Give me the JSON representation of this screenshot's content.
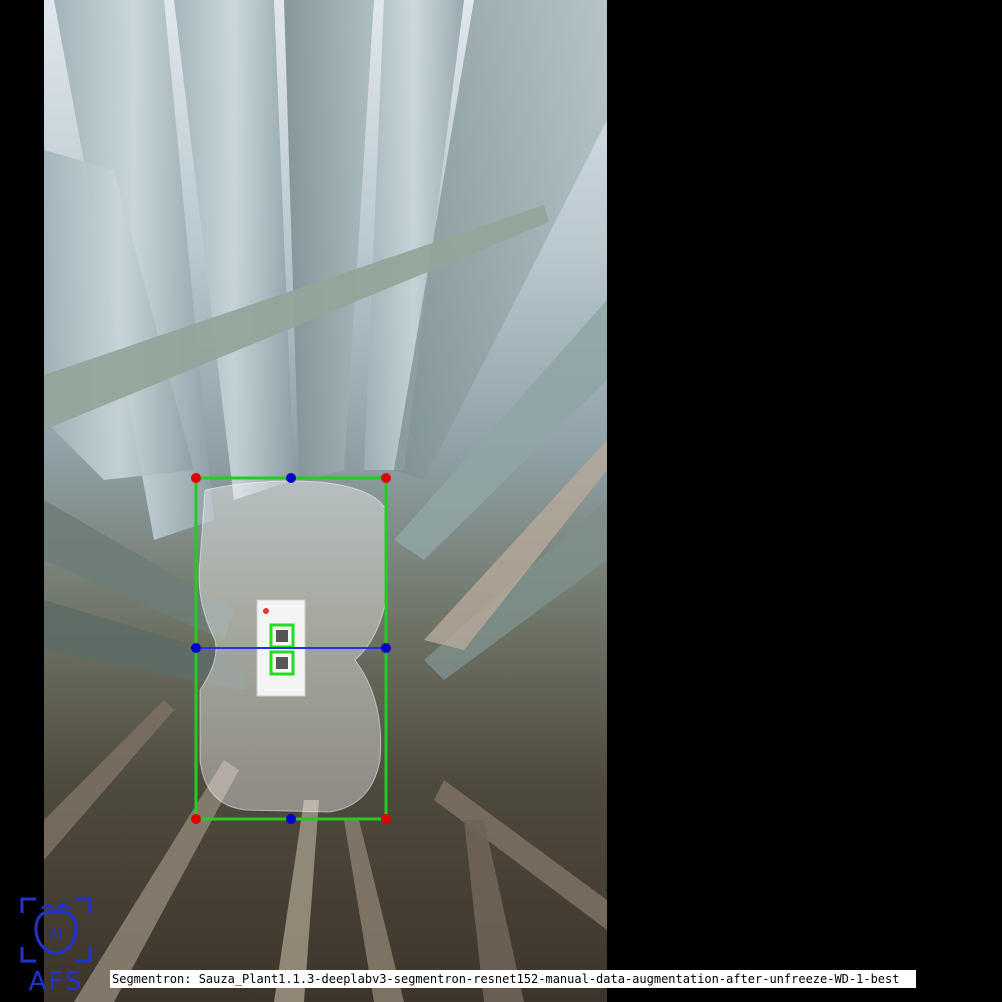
{
  "caption": "Segmentron: Sauza_Plant1.1.3-deeplabv3-segmentron-resnet152-manual-data-augmentation-after-unfreeze-WD-1-best",
  "logo": {
    "text": "AFS",
    "lettering": "AI"
  },
  "colors": {
    "box": "#22cc22",
    "corner_point": "#dd0000",
    "mid_point": "#0000cc",
    "mid_line": "#2233ee",
    "mask": "#ffffff",
    "background": "#000000",
    "logo": "#2233cc"
  },
  "icons": [
    "afs-logo-icon"
  ]
}
